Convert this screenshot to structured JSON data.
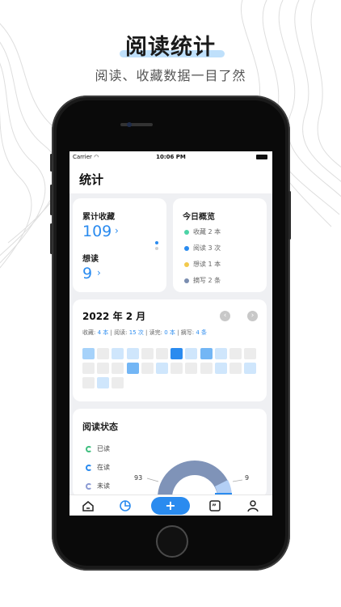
{
  "promo": {
    "headline": "阅读统计",
    "subline": "阅读、收藏数据一目了然"
  },
  "status_bar": {
    "carrier": "Carrier",
    "time": "10:06 PM"
  },
  "nav": {
    "title": "统计"
  },
  "collect_card": {
    "total_label": "累计收藏",
    "total_value": "109",
    "want_label": "想读",
    "want_value": "9",
    "chevron": "›"
  },
  "today_card": {
    "title": "今日概览",
    "items": [
      {
        "label": "收藏 2 本",
        "color": "#4cd3a6"
      },
      {
        "label": "阅读 3 次",
        "color": "#2a8bef"
      },
      {
        "label": "想读 1 本",
        "color": "#f2c94c"
      },
      {
        "label": "摘写 2 条",
        "color": "#7a8db0"
      }
    ]
  },
  "month_card": {
    "title": "2022 年 2 月",
    "prev": "‹",
    "next": "›",
    "stats": {
      "collect_prefix": "收藏: ",
      "collect_value": "4 本",
      "read_prefix": " | 阅读: ",
      "read_value": "15 次",
      "done_prefix": " | 读完: ",
      "done_value": "0 本",
      "note_prefix": " | 摘写: ",
      "note_value": "4 条"
    },
    "heat_levels": [
      2,
      0,
      1,
      1,
      0,
      0,
      4,
      1,
      3,
      1,
      0,
      0,
      0,
      0,
      0,
      3,
      0,
      1,
      0,
      0,
      0,
      1,
      0,
      1,
      0,
      1,
      0
    ]
  },
  "reading_status": {
    "title": "阅读状态",
    "items": [
      {
        "label": "已读",
        "color": "#3fbf7f"
      },
      {
        "label": "在读",
        "color": "#2a8bef"
      },
      {
        "label": "未读",
        "color": "#8c9bd4"
      }
    ],
    "chart_labels": {
      "left": "93",
      "right": "9"
    },
    "colors": {
      "main": "#7f93b8",
      "light": "#b3cff5",
      "accent": "#2a8bef"
    }
  },
  "tabbar": {
    "plus": "+"
  },
  "colors": {
    "accent": "#2a8bef",
    "background": "#eff0f3"
  }
}
